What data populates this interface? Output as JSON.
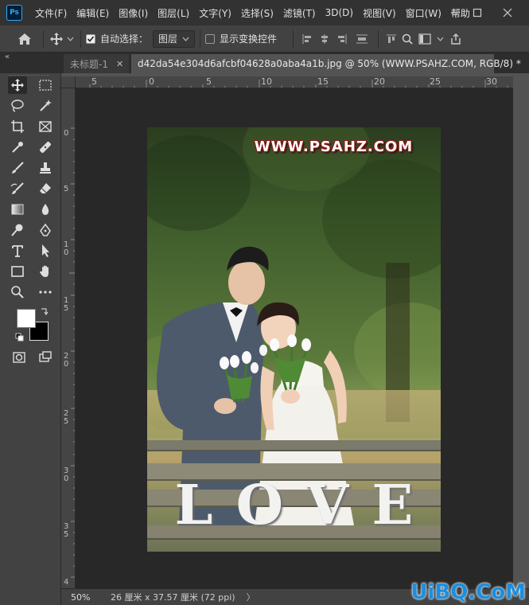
{
  "app": {
    "logo_text": "Ps"
  },
  "menu": [
    "文件(F)",
    "编辑(E)",
    "图像(I)",
    "图层(L)",
    "文字(Y)",
    "选择(S)",
    "滤镜(T)",
    "3D(D)",
    "视图(V)",
    "窗口(W)",
    "帮助"
  ],
  "options": {
    "auto_select_label": "自动选择：",
    "auto_select_checked": true,
    "layer_dropdown": "图层",
    "show_transform_label": "显示变换控件",
    "show_transform_checked": false
  },
  "tabs": [
    {
      "label": "未标题-1",
      "active": false
    },
    {
      "label": "d42da54e304d6afcbf04628a0aba4a1b.jpg @ 50% (WWW.PSAHZ.COM, RGB/8) *",
      "active": true
    }
  ],
  "ruler_h": [
    "5",
    "0",
    "5",
    "10",
    "15",
    "20",
    "25",
    "30"
  ],
  "ruler_v": [
    "0",
    "5",
    "10",
    "15",
    "20",
    "25",
    "30",
    "35",
    "4"
  ],
  "colors": {
    "foreground": "#ffffff",
    "background": "#000000"
  },
  "photo": {
    "watermark": "WWW.PSAHZ.COM",
    "letters": [
      "L",
      "O",
      "V",
      "E"
    ]
  },
  "status": {
    "zoom": "50%",
    "doc_info": "26 厘米 x 37.57 厘米 (72 ppi)",
    "arrow": "〉"
  },
  "site_logo": "UiBQ.CoM"
}
